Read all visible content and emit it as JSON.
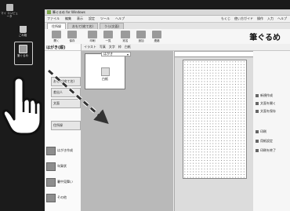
{
  "desktop": {
    "icons": [
      {
        "name": "my-computer-icon",
        "label": "マイ コンピュータ"
      },
      {
        "name": "trash-icon",
        "label": "ごみ箱"
      },
      {
        "name": "app-shortcut-icon",
        "label": "筆ぐるめ"
      }
    ]
  },
  "window": {
    "title": "筆ぐるめ for Windows",
    "menu": [
      "ファイル",
      "編集",
      "表示",
      "設定",
      "ツール",
      "ヘルプ"
    ],
    "menu_right": [
      "もくじ",
      "使い方ガイド",
      "操作",
      "入力",
      "ヘルプ"
    ],
    "tabs": [
      {
        "label": "住所録",
        "active": true
      },
      {
        "label": "おもて(宛て名)",
        "active": false
      },
      {
        "label": "うら(文面)",
        "active": false
      }
    ],
    "ribbon_buttons": [
      "開く",
      "保存",
      "印刷",
      "一覧",
      "宛名",
      "追加",
      "連絡"
    ],
    "logo_text": "筆ぐるめ"
  },
  "sidebar": {
    "header": "はがき(縦)",
    "items": [
      "おもて(宛て名)",
      "差出人",
      "文面",
      "住所録",
      "はがき作成",
      "年賀状",
      "暑中見舞い",
      "その他"
    ]
  },
  "toolbar2": {
    "items": [
      "イラスト",
      "写真",
      "文字",
      "枠",
      "白紙"
    ]
  },
  "card": {
    "label": "白紙",
    "pane_header": "はがき"
  },
  "right_panel": {
    "buttons": [
      "新規作成",
      "文面を開く",
      "文面を保存",
      "印刷",
      "用紙設定",
      "印刷を終了"
    ]
  },
  "colors": {
    "accent": "#7aa34a",
    "card_pane": "#b9b9b9",
    "desktop_bg": "#1b1b1b"
  }
}
